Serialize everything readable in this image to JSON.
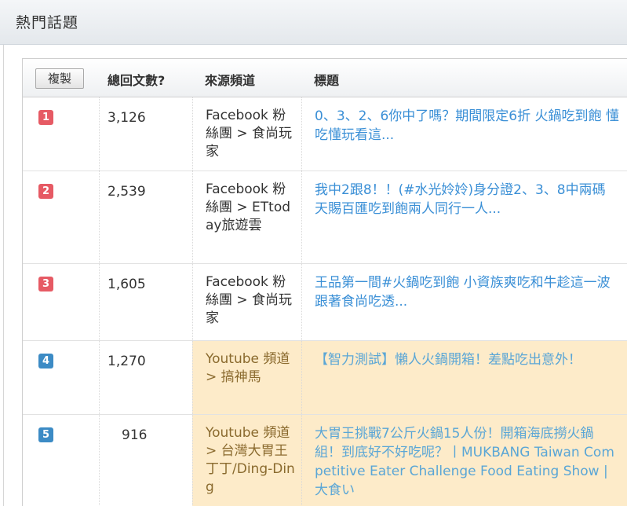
{
  "panel": {
    "title": "熱門話題"
  },
  "table": {
    "copy_button": "複製",
    "headers": {
      "count": "總回文數?",
      "source": "來源頻道",
      "title": "標題"
    },
    "rows": [
      {
        "rank": "1",
        "count": "3,126",
        "source": "Facebook 粉絲團 > 食尚玩家",
        "title": "0、3、2、6你中了嗎？期間限定6折 火鍋吃到飽 懂吃懂玩看這...",
        "highlighted": false,
        "badge_color": "#e65a64"
      },
      {
        "rank": "2",
        "count": "2,539",
        "source": "Facebook 粉絲團 > ETtoday旅遊雲",
        "title": "我中2跟8！！(#水光姈姈)身分證2、3、8中兩碼　天賜百匯吃到飽兩人同行一人...",
        "highlighted": false,
        "badge_color": "#e65a64"
      },
      {
        "rank": "3",
        "count": "1,605",
        "source": "Facebook 粉絲團 > 食尚玩家",
        "title": "王品第一間#火鍋吃到飽 小資族爽吃和牛趁這一波 跟著食尚吃透...",
        "highlighted": false,
        "badge_color": "#e65a64"
      },
      {
        "rank": "4",
        "count": "1,270",
        "source": "Youtube 頻道 > 搞神馬",
        "title": "【智力測試】懶人火鍋開箱！差點吃出意外！",
        "highlighted": true,
        "badge_color": "#3c8bc5"
      },
      {
        "rank": "5",
        "count": "916",
        "source": "Youtube 頻道 > 台灣大胃王丁丁/Ding-Ding",
        "title": "大胃王挑戰7公斤火鍋15人份！開箱海底撈火鍋組！到底好不好吃呢？丨MUKBANG Taiwan Competitive Eater Challenge Food Eating Show | 大食い",
        "highlighted": true,
        "badge_color": "#3c8bc5"
      }
    ]
  }
}
